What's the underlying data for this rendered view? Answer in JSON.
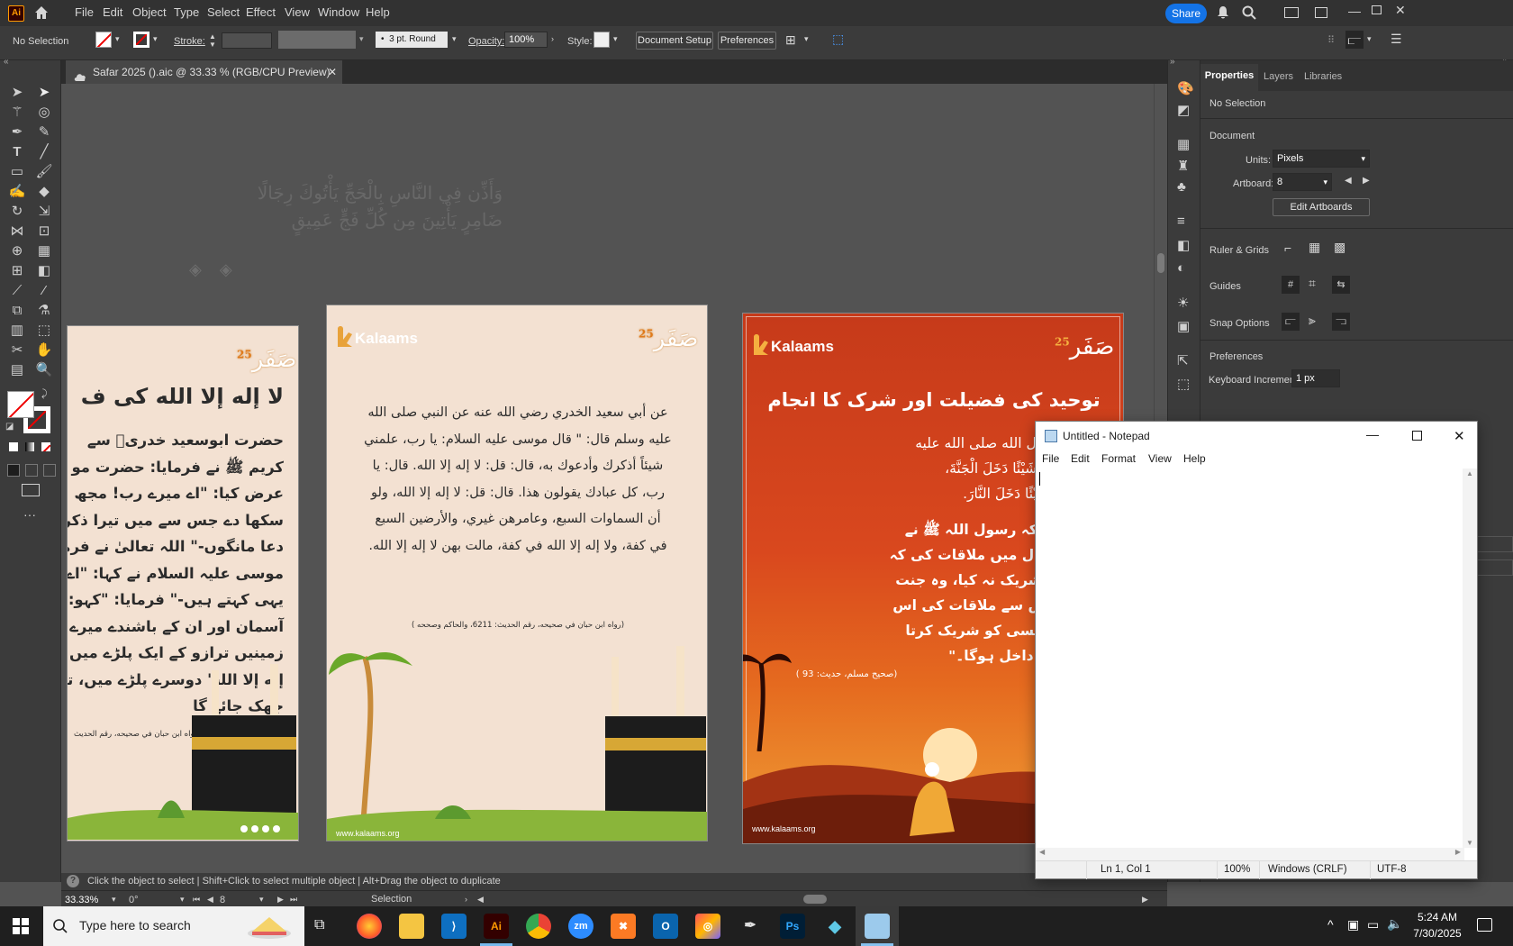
{
  "menubar": {
    "app_badge": "Ai",
    "items": [
      "File",
      "Edit",
      "Object",
      "Type",
      "Select",
      "Effect",
      "View",
      "Window",
      "Help"
    ],
    "share_label": "Share"
  },
  "control_bar": {
    "selection": "No Selection",
    "stroke_label": "Stroke:",
    "brush_value": "3 pt. Round",
    "opacity_label": "Opacity:",
    "opacity_value": "100%",
    "style_label": "Style:",
    "document_setup": "Document Setup",
    "preferences": "Preferences"
  },
  "document": {
    "tab_title": "Safar 2025 ().aic @ 33.33 % (RGB/CPU Preview)"
  },
  "artboards": {
    "left": {
      "headline": "لا إله إلا الله کی ف",
      "body": [
        "حضرت ابوسعید خدریؓ سے",
        "کریم ﷺ نے فرمایا: حضرت مو",
        "عرض کیا: \"اے میرے رب! مجھ",
        "سکھا دے جس سے میں تیرا ذکر",
        "دعا مانگوں-\" اللہ تعالیٰ نے فرمایا",
        "موسی علیہ السلام نے کہا: \"اے رب",
        "یہی کہتے ہیں-\" فرمایا: \"کہو: لا إل",
        "آسمان اور ان کے باشندے میرے",
        "زمینیں ترازو کے ایک پلڑے میں",
        "إله إلا الله' دوسرے پلڑے میں، تو",
        "جھک جائے گا"
      ],
      "reference": "(رواه ابن حبان في صحيحه، رقم الحديث",
      "safar_label": "صَفَر",
      "safar_num": "25"
    },
    "middle": {
      "brand": "Kalaams",
      "safar_label": "صَفَر",
      "safar_num": "25",
      "body": [
        "عن أبي سعيد الخدري رضي الله عنه عن النبي صلى الله",
        "عليه وسلم قال: \" قال موسى عليه السلام: يا رب، علمني",
        "شيئاً أذكرك وأدعوك به، قال: قل: لا إله إلا الله. قال: يا",
        "رب، كل عبادك يقولون هذا. قال: قل: لا إله إلا الله، ولو",
        "أن السماوات السبع، وعامرهن غيري، والأرضين السبع",
        "في كفة، ولا إله إلا الله في كفة، مالت بهن لا إله إلا الله."
      ],
      "reference": "(رواه ابن حبان في صحيحه، رقم الحديث: 6211، والحاكم وصححه )",
      "website": "www.kalaams.org"
    },
    "right": {
      "brand": "Kalaams",
      "safar_label": "صَفَر",
      "safar_num": "25",
      "headline": "توحید کی فضیلت اور شرک کا انجام",
      "arabic": [
        "عنه أن رسول الله صلى الله عليه",
        "لا يُشْرِكُ بِهِ شَيْئًا دَخَلَ الْجَنَّةَ،",
        "يُشْرِكُ بِهِ شَيْئًا دَخَلَ النَّارَ."
      ],
      "urdu": [
        "روایت ہے کہ رسول اللہ ﷺ نے",
        "سے اس حال میں ملاقات کی کہ",
        "کسی کو شریک نہ کیا، وہ جنت",
        "جس نے اس سے ملاقات کی اس",
        "کے ساتھ کسی کو شریک کرتا",
        "جہنم میں داخل ہوگا۔\""
      ],
      "reference": "(صحیح مسلم، حدیث: 93 )",
      "website": "www.kalaams.org"
    },
    "ghost_text": [
      "وَأَذِّن فِي النَّاسِ بِالْحَجِّ يَأْتُوكَ رِجَالًا",
      "ضَامِرٍ يَأْتِينَ مِن كُلِّ فَجٍّ عَمِيقٍ"
    ]
  },
  "properties_panel": {
    "tabs": [
      "Properties",
      "Layers",
      "Libraries"
    ],
    "selection": "No Selection",
    "document_heading": "Document",
    "units_label": "Units:",
    "units_value": "Pixels",
    "artboard_label": "Artboard:",
    "artboard_value": "8",
    "edit_artboards": "Edit Artboards",
    "ruler_grids": "Ruler & Grids",
    "guides": "Guides",
    "snap_options": "Snap Options",
    "preferences": "Preferences",
    "keyboard_increment_label": "Keyboard Increment:",
    "keyboard_increment_value": "1 px"
  },
  "status_bar": {
    "hint": "Click the object to select  |  Shift+Click to select multiple object  |  Alt+Drag the object to duplicate",
    "zoom": "33.33%",
    "rotation": "0°",
    "artboard_num": "8",
    "tool": "Selection"
  },
  "notepad": {
    "title": "Untitled - Notepad",
    "menu": [
      "File",
      "Edit",
      "Format",
      "View",
      "Help"
    ],
    "status": {
      "position": "Ln 1, Col 1",
      "zoom": "100%",
      "line_ending": "Windows (CRLF)",
      "encoding": "UTF-8"
    }
  },
  "taskbar": {
    "search_placeholder": "Type here to search",
    "time": "5:24 AM",
    "date": "7/30/2025",
    "apps": [
      "Task View",
      "Firefox",
      "File Explorer",
      "VS Code",
      "Illustrator",
      "Chrome",
      "Zoom",
      "XAMPP",
      "Outlook",
      "Creative Cloud",
      "Pen Tool",
      "Photoshop",
      "Vector App",
      "Notepad"
    ]
  },
  "colors": {
    "ai_orange": "#ff9a00",
    "ai_bg": "#330000",
    "share_blue": "#1473e6",
    "artboard_cream": "#f3e1d2",
    "artboard_orange": "#d9481e"
  }
}
